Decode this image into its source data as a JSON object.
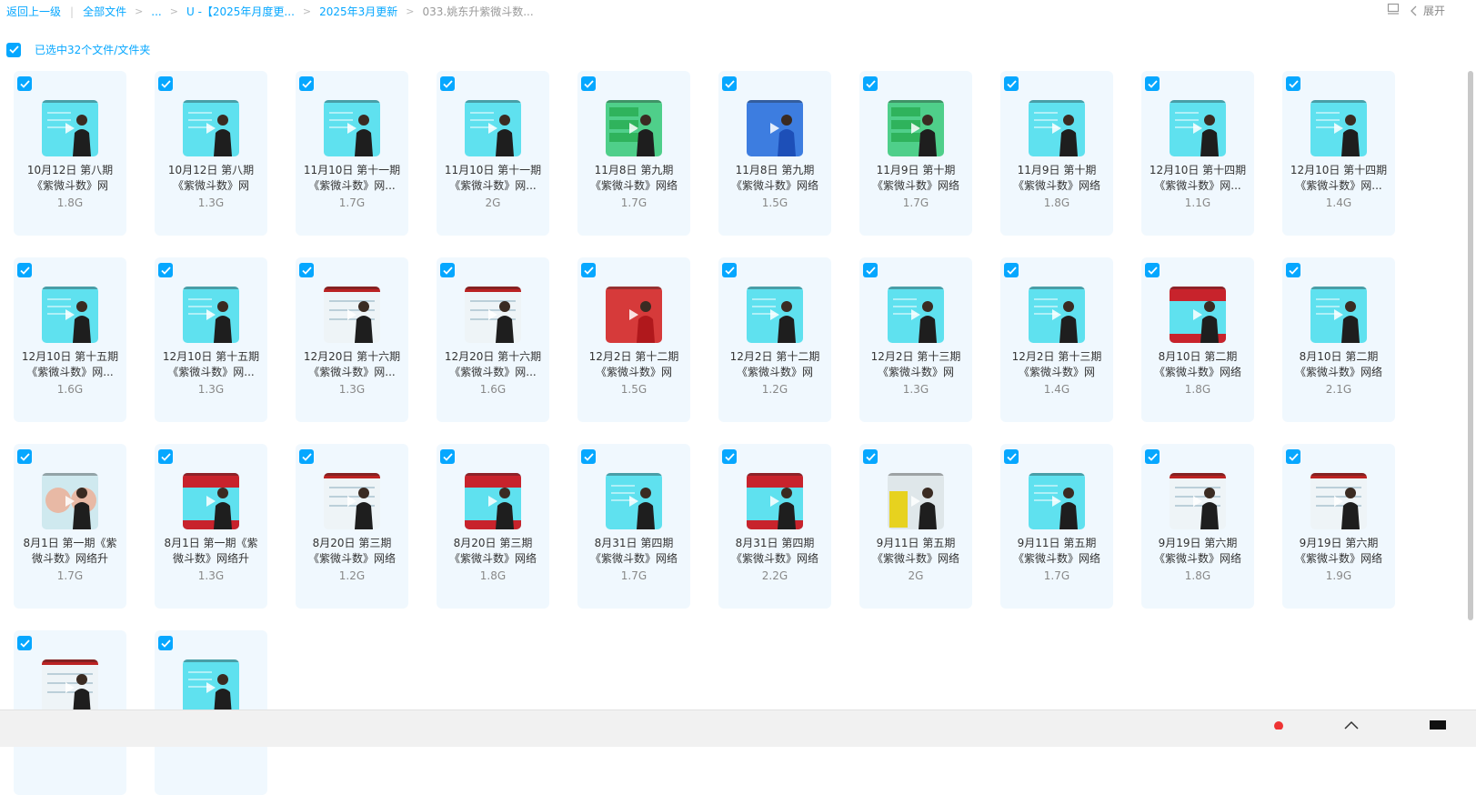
{
  "breadcrumb": {
    "back": "返回上一级",
    "all_files": "全部文件",
    "ellipsis": "...",
    "folder1": "U -【2025年月度更...",
    "folder2": "2025年3月更新",
    "current": "033.姚东升紫微斗数..."
  },
  "toolbar": {
    "expand_label": "展开"
  },
  "selection": {
    "label": "已选中32个文件/文件夹"
  },
  "colors": {
    "accent": "#06a7ff",
    "card_bg": "#f0f8fe"
  },
  "files": [
    {
      "line1": "10月12日 第八期",
      "line2": "《紫微斗数》网",
      "size": "1.8G",
      "thumb": "cyan"
    },
    {
      "line1": "10月12日 第八期",
      "line2": "《紫微斗数》网",
      "size": "1.3G",
      "thumb": "cyan"
    },
    {
      "line1": "11月10日 第十一期",
      "line2": "《紫微斗数》网...",
      "size": "1.7G",
      "thumb": "cyan"
    },
    {
      "line1": "11月10日 第十一期",
      "line2": "《紫微斗数》网...",
      "size": "2G",
      "thumb": "cyan"
    },
    {
      "line1": "11月8日 第九期",
      "line2": "《紫微斗数》网络",
      "size": "1.7G",
      "thumb": "green"
    },
    {
      "line1": "11月8日 第九期",
      "line2": "《紫微斗数》网络",
      "size": "1.5G",
      "thumb": "blue"
    },
    {
      "line1": "11月9日 第十期",
      "line2": "《紫微斗数》网络",
      "size": "1.7G",
      "thumb": "green"
    },
    {
      "line1": "11月9日 第十期",
      "line2": "《紫微斗数》网络",
      "size": "1.8G",
      "thumb": "cyan"
    },
    {
      "line1": "12月10日 第十四期",
      "line2": "《紫微斗数》网...",
      "size": "1.1G",
      "thumb": "cyan"
    },
    {
      "line1": "12月10日 第十四期",
      "line2": "《紫微斗数》网...",
      "size": "1.4G",
      "thumb": "cyan"
    },
    {
      "line1": "12月10日 第十五期",
      "line2": "《紫微斗数》网...",
      "size": "1.6G",
      "thumb": "cyan"
    },
    {
      "line1": "12月10日 第十五期",
      "line2": "《紫微斗数》网...",
      "size": "1.3G",
      "thumb": "cyan"
    },
    {
      "line1": "12月20日 第十六期",
      "line2": "《紫微斗数》网...",
      "size": "1.3G",
      "thumb": "white"
    },
    {
      "line1": "12月20日 第十六期",
      "line2": "《紫微斗数》网...",
      "size": "1.6G",
      "thumb": "white"
    },
    {
      "line1": "12月2日 第十二期",
      "line2": "《紫微斗数》网",
      "size": "1.5G",
      "thumb": "red"
    },
    {
      "line1": "12月2日 第十二期",
      "line2": "《紫微斗数》网",
      "size": "1.2G",
      "thumb": "cyan"
    },
    {
      "line1": "12月2日 第十三期",
      "line2": "《紫微斗数》网",
      "size": "1.3G",
      "thumb": "cyan"
    },
    {
      "line1": "12月2日 第十三期",
      "line2": "《紫微斗数》网",
      "size": "1.4G",
      "thumb": "cyan"
    },
    {
      "line1": "8月10日 第二期",
      "line2": "《紫微斗数》网络",
      "size": "1.8G",
      "thumb": "redbanner"
    },
    {
      "line1": "8月10日 第二期",
      "line2": "《紫微斗数》网络",
      "size": "2.1G",
      "thumb": "cyan"
    },
    {
      "line1": "8月1日 第一期《紫",
      "line2": "微斗数》网络升",
      "size": "1.7G",
      "thumb": "face"
    },
    {
      "line1": "8月1日 第一期《紫",
      "line2": "微斗数》网络升",
      "size": "1.3G",
      "thumb": "redbanner"
    },
    {
      "line1": "8月20日 第三期",
      "line2": "《紫微斗数》网络",
      "size": "1.2G",
      "thumb": "white"
    },
    {
      "line1": "8月20日 第三期",
      "line2": "《紫微斗数》网络",
      "size": "1.8G",
      "thumb": "redbanner"
    },
    {
      "line1": "8月31日 第四期",
      "line2": "《紫微斗数》网络",
      "size": "1.7G",
      "thumb": "cyan"
    },
    {
      "line1": "8月31日 第四期",
      "line2": "《紫微斗数》网络",
      "size": "2.2G",
      "thumb": "redbanner"
    },
    {
      "line1": "9月11日 第五期",
      "line2": "《紫微斗数》网络",
      "size": "2G",
      "thumb": "yellow"
    },
    {
      "line1": "9月11日 第五期",
      "line2": "《紫微斗数》网络",
      "size": "1.7G",
      "thumb": "cyan"
    },
    {
      "line1": "9月19日 第六期",
      "line2": "《紫微斗数》网络",
      "size": "1.8G",
      "thumb": "white"
    },
    {
      "line1": "9月19日 第六期",
      "line2": "《紫微斗数》网络",
      "size": "1.9G",
      "thumb": "white"
    },
    {
      "line1": "",
      "line2": "",
      "size": "",
      "thumb": "white"
    },
    {
      "line1": "",
      "line2": "",
      "size": "",
      "thumb": "cyan"
    }
  ]
}
